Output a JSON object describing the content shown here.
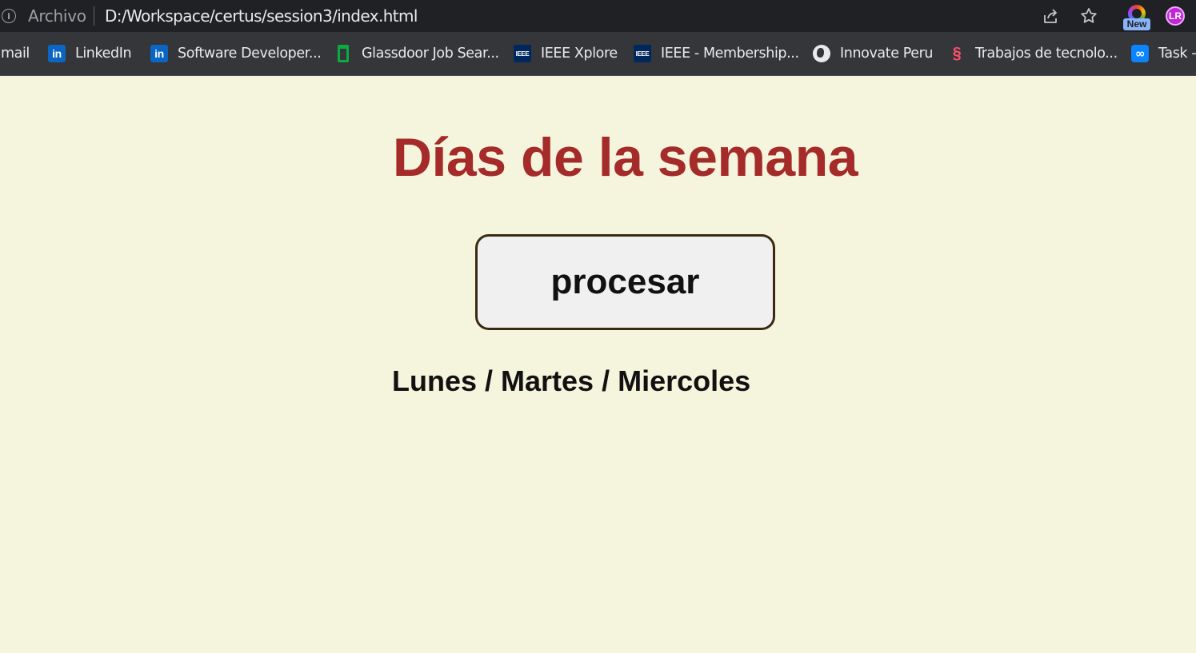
{
  "browser": {
    "scheme_label": "Archivo",
    "url": "D:/Workspace/certus/session3/index.html",
    "extension_badge": "New",
    "profile_initials": "LR"
  },
  "bookmarks": [
    {
      "label": "mail",
      "icon": "none"
    },
    {
      "label": "LinkedIn",
      "icon": "linkedin-icon"
    },
    {
      "label": "Software Developer...",
      "icon": "linkedin-icon"
    },
    {
      "label": "Glassdoor Job Sear...",
      "icon": "glassdoor-icon"
    },
    {
      "label": "IEEE Xplore",
      "icon": "ieee-icon"
    },
    {
      "label": "IEEE - Membership...",
      "icon": "ieee-icon"
    },
    {
      "label": "Innovate Peru",
      "icon": "globe-icon"
    },
    {
      "label": "Trabajos de tecnolo...",
      "icon": "trabajos-icon"
    },
    {
      "label": "Task -",
      "icon": "task-infinity-icon"
    }
  ],
  "page": {
    "title": "Días de la semana",
    "button_label": "procesar",
    "result": "Lunes / Martes / Miercoles"
  },
  "colors": {
    "background": "#f5f4dc",
    "title": "#a52a2a",
    "button_border": "#3b2a12"
  }
}
